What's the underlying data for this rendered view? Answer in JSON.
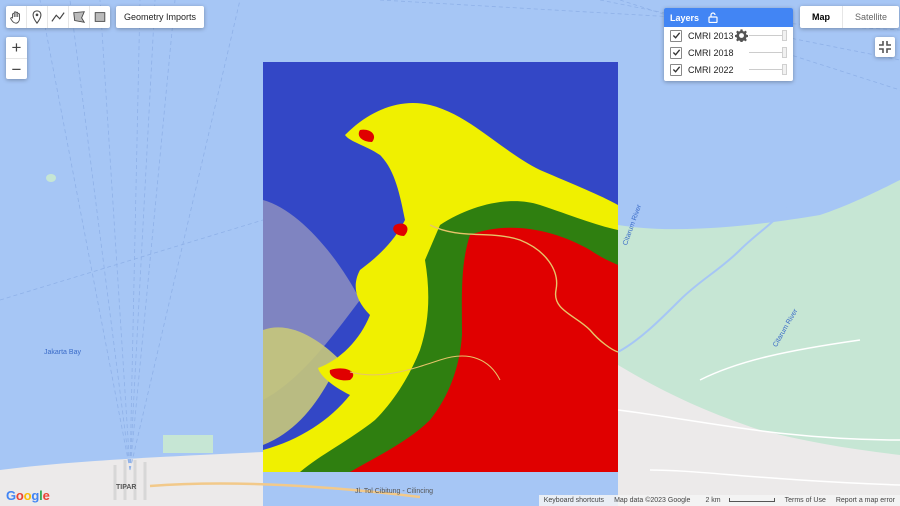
{
  "toolbar": {
    "tools": [
      "hand-icon",
      "marker-icon",
      "polyline-icon",
      "polygon-icon",
      "rectangle-icon"
    ],
    "geometry_imports_label": "Geometry Imports"
  },
  "zoom": {
    "in_label": "+",
    "out_label": "−"
  },
  "layers_panel": {
    "title": "Layers",
    "layers": [
      {
        "name": "CMRI 2013",
        "checked": true,
        "opacity": 1.0
      },
      {
        "name": "CMRI 2018",
        "checked": true,
        "opacity": 1.0
      },
      {
        "name": "CMRI 2022",
        "checked": true,
        "opacity": 1.0
      }
    ]
  },
  "map_type": {
    "map_label": "Map",
    "satellite_label": "Satellite",
    "selected": "Map"
  },
  "map_labels": {
    "jakarta_bay": "Jakarta Bay",
    "citarum_1": "Citarum River",
    "citarum_2": "Citarum River",
    "tipar": "TIPAR",
    "toll_road": "Jl. Tol Cibitung - Cilincing"
  },
  "footer": {
    "keyboard": "Keyboard shortcuts",
    "map_data": "Map data ©2023 Google",
    "scale": "2 km",
    "terms": "Terms of Use",
    "report": "Report a map error"
  },
  "logo_text": "Google",
  "colors": {
    "water": "#a6c6f5",
    "land": "#eceaea",
    "park": "#c6e6d4",
    "accent": "#4285f4",
    "index_low": "#2f3fbe",
    "index_mid": "#f0f000",
    "index_high": "#e00000",
    "vegetation": "#2f7f10"
  }
}
